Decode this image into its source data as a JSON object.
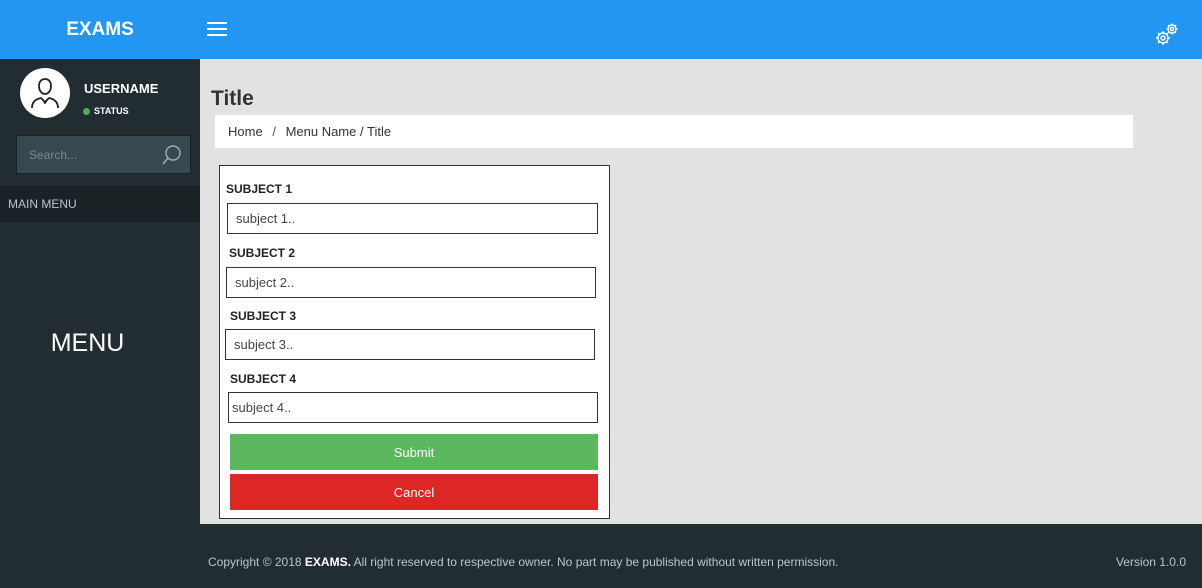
{
  "header": {
    "brand": "EXAMS",
    "menu_icon": "hamburger-icon",
    "settings_icon": "gears-icon",
    "color": "#2196f3"
  },
  "sidebar": {
    "username": "USERNAME",
    "status": "STATUS",
    "status_color": "#4caf50",
    "search_placeholder": "Search...",
    "main_menu": "MAIN MENU",
    "menu_label": "MENU"
  },
  "page": {
    "title": "Title",
    "breadcrumb": [
      "Home",
      "Menu Name",
      "Title"
    ]
  },
  "form": {
    "fields": [
      {
        "label": "SUBJECT 1",
        "placeholder": "subject 1.."
      },
      {
        "label": "SUBJECT 2",
        "placeholder": "subject 2.."
      },
      {
        "label": "SUBJECT 3",
        "placeholder": "subject 3.."
      },
      {
        "label": "SUBJECT 4",
        "placeholder": "subject 4.."
      }
    ],
    "submit_label": "Submit",
    "cancel_label": "Cancel",
    "submit_color": "#5cb85c",
    "cancel_color": "#dd2626"
  },
  "footer": {
    "copyright_prefix": "Copyright © 2018 ",
    "copyright_brand": "EXAMS.",
    "copyright_suffix": " All right reserved to respective owner. No part may be published without written permission.",
    "version": "Version 1.0.0"
  }
}
